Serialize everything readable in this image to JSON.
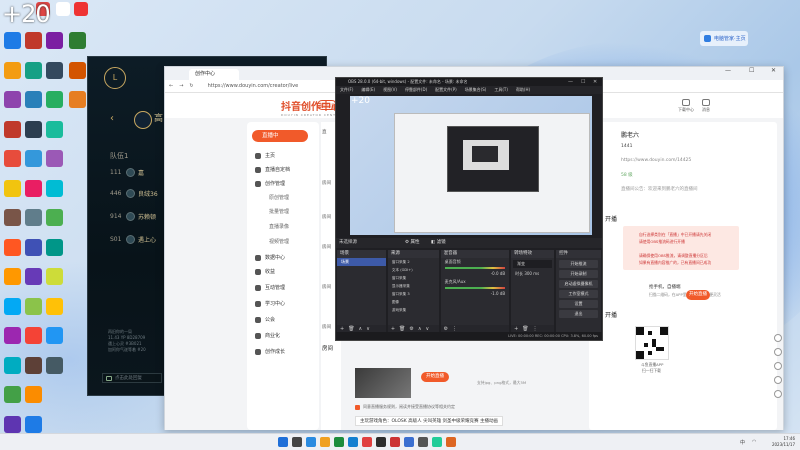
{
  "overlay": {
    "zoom_text": "+20"
  },
  "desktop": {
    "notification": "电脑管家·主页",
    "icon_labels": [
      "",
      "",
      "",
      "",
      "",
      "",
      "",
      "",
      "",
      "",
      "",
      "",
      "",
      "",
      "",
      "",
      "",
      "",
      "",
      "",
      "",
      "",
      "",
      "",
      "",
      "",
      "",
      "",
      "",
      "",
      "",
      "",
      "",
      "",
      "",
      "",
      "",
      "",
      "",
      "",
      "",
      "",
      ""
    ]
  },
  "lol": {
    "title": "高",
    "team_label": "队伍1",
    "rows": [
      {
        "lv": "111",
        "name": "嘉"
      },
      {
        "lv": "446",
        "name": "良绒36"
      },
      {
        "lv": "914",
        "name": "苏赖顿"
      },
      {
        "lv": "S01",
        "name": "遇上心"
      }
    ],
    "chat_log": "再旧你的一局\n11.43 YP 8D28709\n遇上心灵 #3B021\n加阿你气遂等着 #20",
    "chat_placeholder": "点击此处回复"
  },
  "browser": {
    "tab_title": "创作中心",
    "url": "https://www.douyin.com/creator/live",
    "site_logo": "抖音创作中心",
    "site_logo_sub": "DOUYIN CREATOR CENTER",
    "header_btn": "返回抖音",
    "header_right": [
      "下载中心",
      "消息"
    ],
    "sidebar": {
      "live_button": "直播中",
      "items": [
        {
          "label": "主页",
          "sub": false
        },
        {
          "label": "直播自定档",
          "sub": false
        },
        {
          "label": "创作管理",
          "sub": false
        },
        {
          "label": "原创管理",
          "sub": true
        },
        {
          "label": "批量管理",
          "sub": true
        },
        {
          "label": "直播录像",
          "sub": true
        },
        {
          "label": "视频管理",
          "sub": true
        },
        {
          "label": "数据中心",
          "sub": false
        },
        {
          "label": "收益",
          "sub": false
        },
        {
          "label": "互动管理",
          "sub": false
        },
        {
          "label": "学习中心",
          "sub": false
        },
        {
          "label": "公会",
          "sub": false
        },
        {
          "label": "商业化",
          "sub": false
        },
        {
          "label": "创作成长",
          "sub": false
        }
      ]
    },
    "mid_labels": [
      "直",
      "房间",
      "房间",
      "房间",
      "房间",
      "房间"
    ],
    "right": {
      "username": "鹏老六",
      "fans_label": "1441",
      "link_text": "https://www.douyin.com/14425",
      "level": "58 级",
      "desc": "直播间公告：欢迎来到鹏老六的直播间",
      "section_start": "开播",
      "red_items": [
        "自行选择类别在「直播」中已开播请先关闭",
        "请使用OBS推流码进行开播"
      ],
      "red_items2": [
        "请确保使用OBS推流，请调整直播分区后",
        "如果有直播内容推广的，已有直播间已成功"
      ],
      "phone_box_title": "抢手机，自播端",
      "phone_box_desc": "扫描二维码，在APP里进行直播，方便灵活",
      "start_btn": "开始直播",
      "section_start2": "开播",
      "qr_caption": "斗鱼直播APP",
      "qr_caption2": "扫一扫下载"
    },
    "bottom": {
      "room_label": "房间",
      "cover_btn": "开始直播",
      "cover_desc": "支持jpg、png格式，最大5M",
      "checkbox_text": "同意直播服务规则，阅读并接受直播协议等相关约定",
      "tags": "主玩游戏角色：OLOSK 高级人 尖叫英雄 剑圣中级荣耀竞赛 主播动画"
    }
  },
  "obs": {
    "title": "OBS 28.0.0 (64-bit, windows) - 配置文件: 未命名 - 场景: 未命名",
    "menu": [
      "文件(F)",
      "编辑(E)",
      "视图(V)",
      "停靠部件(D)",
      "配置文件(P)",
      "场景集合(S)",
      "工具(T)",
      "帮助(H)"
    ],
    "preview_zoom": "+20",
    "scene_label": "未选择源",
    "props_btn": "属性",
    "filters_btn": "滤镜",
    "docks": {
      "scenes": {
        "title": "场景",
        "items": [
          "场景"
        ]
      },
      "sources": {
        "title": "来源",
        "items": [
          "窗口采集 2",
          "文本 (GDI+)",
          "窗口采集",
          "显示器采集",
          "窗口采集 3",
          "图像",
          "游戏采集"
        ]
      },
      "mixer": {
        "title": "混音器",
        "items": [
          "桌面音频",
          "-0.0 dB",
          "麦克风/Aux",
          "-1.0 dB"
        ]
      },
      "transitions": {
        "title": "转场特效",
        "items": [
          "渐变",
          "时长 300 ms"
        ]
      },
      "controls": {
        "title": "控件",
        "items": [
          "开始推流",
          "开始录制",
          "启动虚拟摄像机",
          "工作室模式",
          "设置",
          "退出"
        ]
      }
    },
    "status": "LIVE: 00:00:00   REC: 00:00:00   CPU: 3.8%, 60.00 fps"
  },
  "taskbar": {
    "time": "17:46",
    "date": "2023/11/17",
    "lang": "中"
  }
}
